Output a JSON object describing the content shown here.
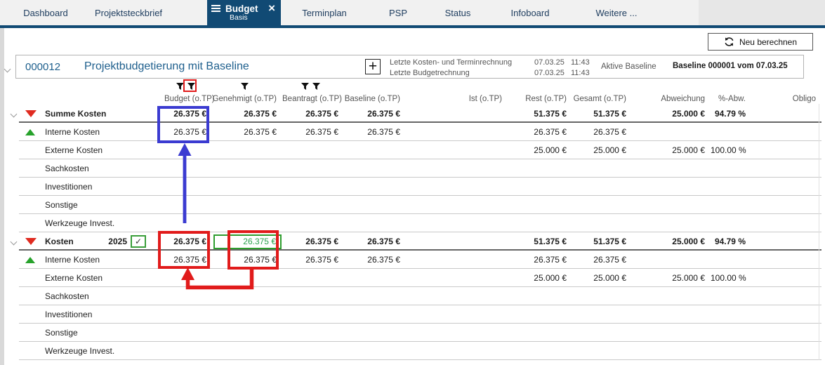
{
  "colors": {
    "accent_navy": "#114a74",
    "title_blue": "#1e5f8d",
    "annotation_red": "#e11b1b",
    "annotation_blue": "#3b3bd1",
    "triangle_red": "#e02b20",
    "triangle_green": "#27a22b",
    "edit_green": "#2aa14d"
  },
  "tabs": {
    "items": [
      {
        "label": "Dashboard"
      },
      {
        "label": "Projektsteckbrief"
      },
      {
        "label": "Budget",
        "sublabel": "Basis",
        "active": true
      },
      {
        "label": "Terminplan"
      },
      {
        "label": "PSP"
      },
      {
        "label": "Status"
      },
      {
        "label": "Infoboard"
      },
      {
        "label": "Weitere ..."
      }
    ]
  },
  "toolbar": {
    "recalc_label": "Neu berechnen"
  },
  "project": {
    "id": "000012",
    "title": "Projektbudgetierung mit Baseline",
    "calc_rows": [
      {
        "label": "Letzte Kosten- und Terminrechnung",
        "date": "07.03.25",
        "time": "11:43"
      },
      {
        "label": "Letzte Budgetrechnung",
        "date": "07.03.25",
        "time": "11:43"
      }
    ],
    "baseline_label": "Aktive Baseline",
    "baseline_value": "Baseline 000001 vom 07.03.25"
  },
  "table": {
    "headers": [
      "Budget (o.TP)",
      "Genehmigt (o.TP)",
      "Beantragt (o.TP)",
      "Baseline (o.TP)",
      "Ist (o.TP)",
      "Rest (o.TP)",
      "Gesamt (o.TP)",
      "Abweichung",
      "%-Abw.",
      "Obligo"
    ],
    "filter_counts": [
      2,
      1,
      2,
      0,
      0,
      0,
      0,
      0,
      0,
      0
    ],
    "rows": [
      {
        "name": "Summe Kosten",
        "group": true,
        "chevron": true,
        "icon": "red-down",
        "values": [
          "26.375 €",
          "26.375 €",
          "26.375 €",
          "26.375 €",
          "",
          "51.375 €",
          "51.375 €",
          "25.000 €",
          "94.79 %",
          ""
        ]
      },
      {
        "name": "Interne Kosten",
        "icon": "green-up",
        "values": [
          "26.375 €",
          "26.375 €",
          "26.375 €",
          "26.375 €",
          "",
          "26.375 €",
          "26.375 €",
          "",
          "",
          ""
        ]
      },
      {
        "name": "Externe Kosten",
        "values": [
          "",
          "",
          "",
          "",
          "",
          "25.000 €",
          "25.000 €",
          "25.000 €",
          "100.00 %",
          ""
        ]
      },
      {
        "name": "Sachkosten",
        "values": [
          "",
          "",
          "",
          "",
          "",
          "",
          "",
          "",
          "",
          ""
        ]
      },
      {
        "name": "Investitionen",
        "values": [
          "",
          "",
          "",
          "",
          "",
          "",
          "",
          "",
          "",
          ""
        ]
      },
      {
        "name": "Sonstige",
        "values": [
          "",
          "",
          "",
          "",
          "",
          "",
          "",
          "",
          "",
          ""
        ]
      },
      {
        "name": "Werkzeuge Invest.",
        "values": [
          "",
          "",
          "",
          "",
          "",
          "",
          "",
          "",
          "",
          ""
        ]
      },
      {
        "name": "Kosten",
        "year": "2025",
        "checkbox": true,
        "checkmark": "✓",
        "group": true,
        "chevron": true,
        "icon": "red-down",
        "highlight_genehmigt": true,
        "values": [
          "26.375 €",
          "26.375 €",
          "26.375 €",
          "26.375 €",
          "",
          "51.375 €",
          "51.375 €",
          "25.000 €",
          "94.79 %",
          ""
        ]
      },
      {
        "name": "Interne Kosten",
        "icon": "green-up",
        "values": [
          "26.375 €",
          "26.375 €",
          "26.375 €",
          "26.375 €",
          "",
          "26.375 €",
          "26.375 €",
          "",
          "",
          ""
        ]
      },
      {
        "name": "Externe Kosten",
        "values": [
          "",
          "",
          "",
          "",
          "",
          "25.000 €",
          "25.000 €",
          "25.000 €",
          "100.00 %",
          ""
        ]
      },
      {
        "name": "Sachkosten",
        "values": [
          "",
          "",
          "",
          "",
          "",
          "",
          "",
          "",
          "",
          ""
        ]
      },
      {
        "name": "Investitionen",
        "values": [
          "",
          "",
          "",
          "",
          "",
          "",
          "",
          "",
          "",
          ""
        ]
      },
      {
        "name": "Sonstige",
        "values": [
          "",
          "",
          "",
          "",
          "",
          "",
          "",
          "",
          "",
          ""
        ]
      },
      {
        "name": "Werkzeuge Invest.",
        "values": [
          "",
          "",
          "",
          "",
          "",
          "",
          "",
          "",
          "",
          ""
        ]
      }
    ]
  }
}
